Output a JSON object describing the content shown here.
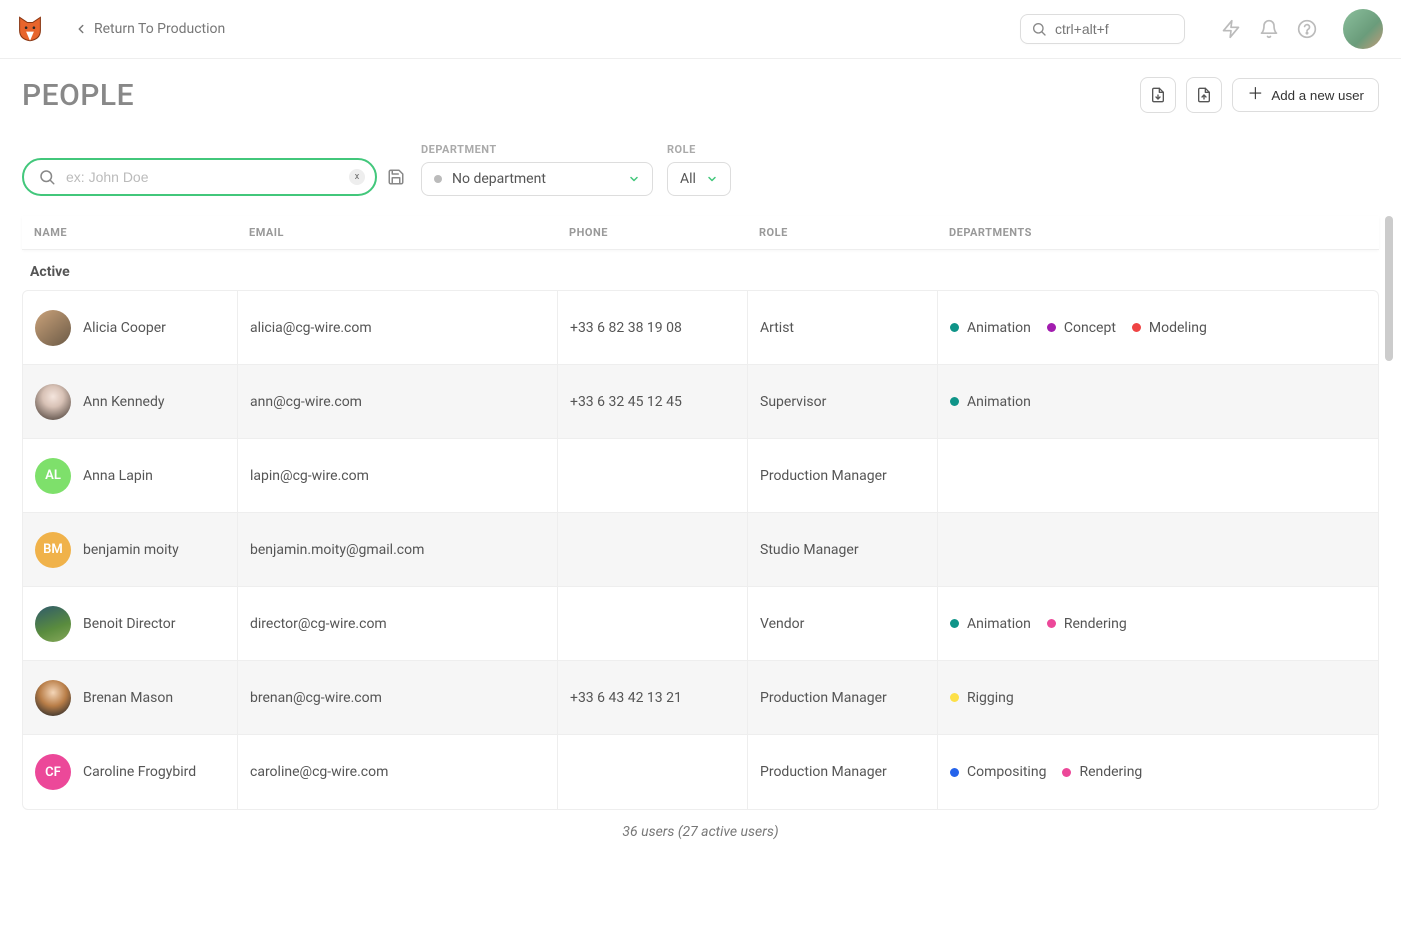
{
  "header": {
    "breadcrumb": "Return To Production",
    "search_placeholder": "ctrl+alt+f"
  },
  "page": {
    "title": "PEOPLE",
    "add_user": "Add a new user"
  },
  "filters": {
    "search_placeholder": "ex: John Doe",
    "department_label": "DEPARTMENT",
    "department_value": "No department",
    "role_label": "ROLE",
    "role_value": "All"
  },
  "columns": {
    "name": "NAME",
    "email": "EMAIL",
    "phone": "PHONE",
    "role": "ROLE",
    "departments": "DEPARTMENTS"
  },
  "section": "Active",
  "dept_colors": {
    "Animation": "#0f9488",
    "Concept": "#a21caf",
    "Modeling": "#ef4444",
    "Rendering": "#ec4899",
    "Rigging": "#fde047",
    "Compositing": "#2563eb"
  },
  "users": [
    {
      "name": "Alicia Cooper",
      "email": "alicia@cg-wire.com",
      "phone": "+33 6 82 38 19 08",
      "role": "Artist",
      "departments": [
        "Animation",
        "Concept",
        "Modeling"
      ],
      "avatar": {
        "type": "photo",
        "bg": "linear-gradient(140deg,#caa27a 0%, #6b5a46 100%)"
      }
    },
    {
      "name": "Ann Kennedy",
      "email": "ann@cg-wire.com",
      "phone": "+33 6 32 45 12 45",
      "role": "Supervisor",
      "departments": [
        "Animation"
      ],
      "avatar": {
        "type": "photo",
        "bg": "radial-gradient(circle at 50% 35%, #f4e5dd 0%, #d8c2b6 35%, #6b5d55 80%)"
      }
    },
    {
      "name": "Anna Lapin",
      "email": "lapin@cg-wire.com",
      "phone": "",
      "role": "Production Manager",
      "departments": [],
      "avatar": {
        "type": "initials",
        "text": "AL",
        "bg": "#7ee06b"
      }
    },
    {
      "name": "benjamin moity",
      "email": "benjamin.moity@gmail.com",
      "phone": "",
      "role": "Studio Manager",
      "departments": [],
      "avatar": {
        "type": "initials",
        "text": "BM",
        "bg": "#f0b24a"
      }
    },
    {
      "name": "Benoit Director",
      "email": "director@cg-wire.com",
      "phone": "",
      "role": "Vendor",
      "departments": [
        "Animation",
        "Rendering"
      ],
      "avatar": {
        "type": "photo",
        "bg": "linear-gradient(160deg,#2f5a6b 0%, #5a8c3e 60%, #86a85a 100%)"
      }
    },
    {
      "name": "Brenan Mason",
      "email": "brenan@cg-wire.com",
      "phone": "+33 6 43 42 13 21",
      "role": "Production Manager",
      "departments": [
        "Rigging"
      ],
      "avatar": {
        "type": "photo",
        "bg": "radial-gradient(circle at 50% 35%, #f4d6b8 0%, #b97e48 45%, #2a2a2a 90%)"
      }
    },
    {
      "name": "Caroline Frogybird",
      "email": "caroline@cg-wire.com",
      "phone": "",
      "role": "Production Manager",
      "departments": [
        "Compositing",
        "Rendering"
      ],
      "avatar": {
        "type": "initials",
        "text": "CF",
        "bg": "#ec4899"
      }
    }
  ],
  "footer": "36 users (27 active users)"
}
